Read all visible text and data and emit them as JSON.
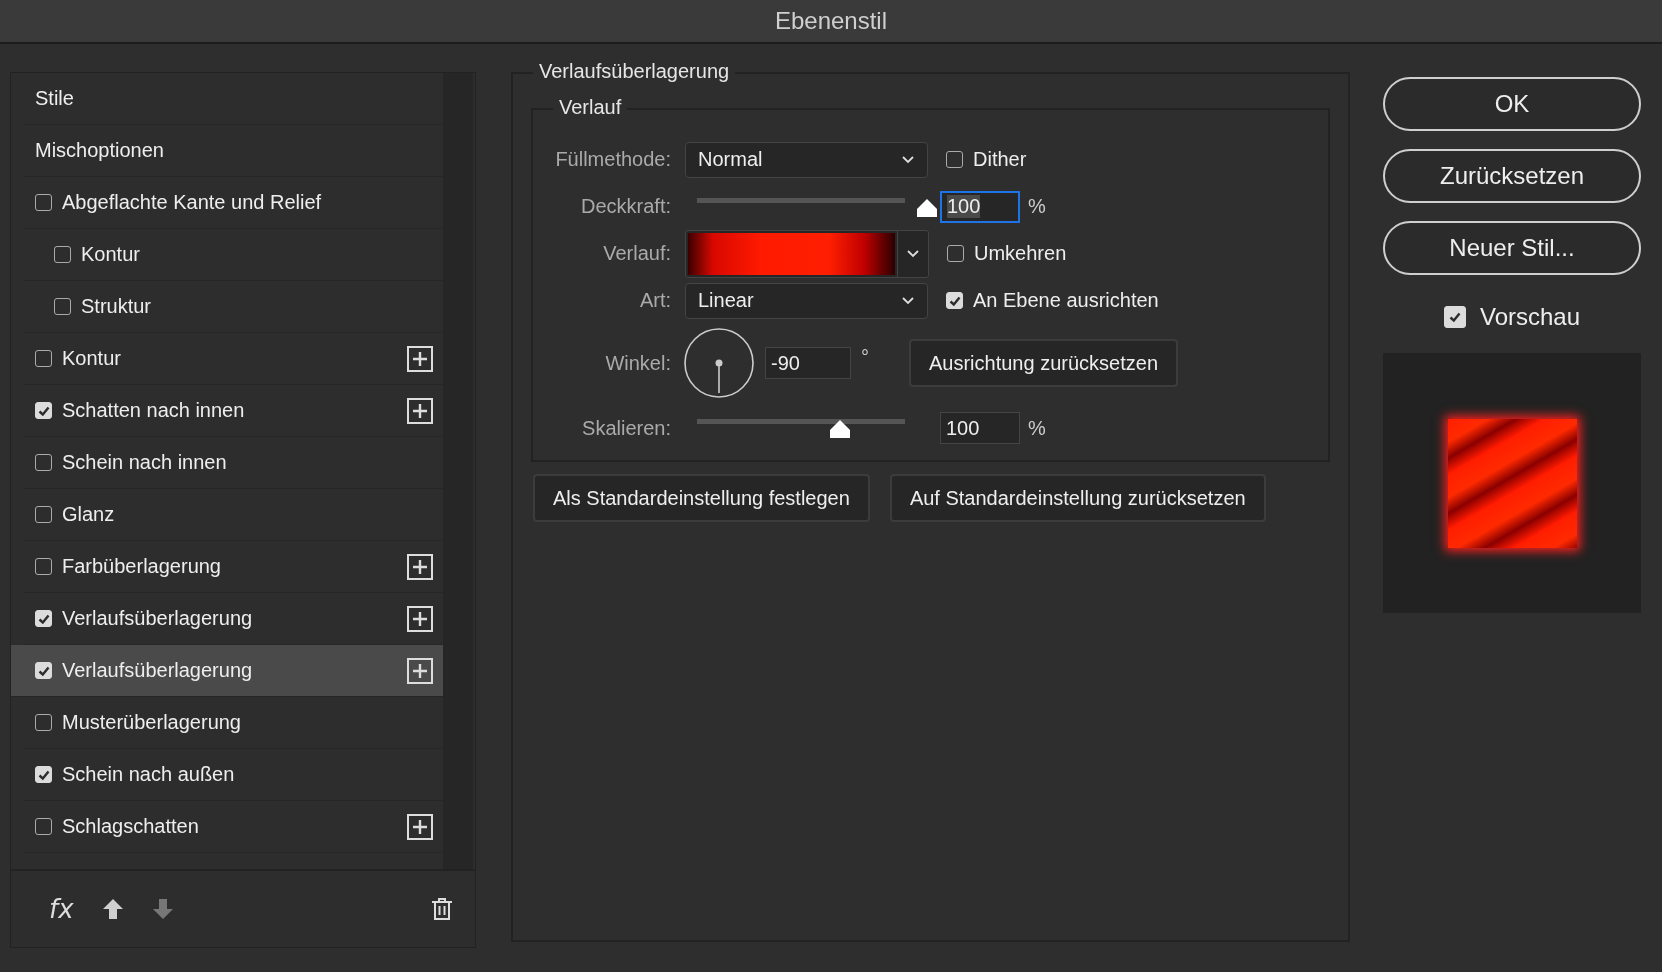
{
  "window": {
    "title": "Ebenenstil"
  },
  "sidebar": {
    "items": [
      {
        "label": "Stile",
        "kind": "plain",
        "selected": false
      },
      {
        "label": "Mischoptionen",
        "kind": "plain",
        "selected": false
      },
      {
        "label": "Abgeflachte Kante und Relief",
        "kind": "checkbox",
        "checked": false,
        "add_button": false,
        "selected": false,
        "children": [
          {
            "label": "Kontur",
            "kind": "checkbox",
            "checked": false,
            "add_button": false,
            "selected": false
          },
          {
            "label": "Struktur",
            "kind": "checkbox",
            "checked": false,
            "add_button": false,
            "selected": false
          }
        ]
      },
      {
        "label": "Kontur",
        "kind": "checkbox",
        "checked": false,
        "add_button": true,
        "selected": false
      },
      {
        "label": "Schatten nach innen",
        "kind": "checkbox",
        "checked": true,
        "add_button": true,
        "selected": false
      },
      {
        "label": "Schein nach innen",
        "kind": "checkbox",
        "checked": false,
        "add_button": false,
        "selected": false
      },
      {
        "label": "Glanz",
        "kind": "checkbox",
        "checked": false,
        "add_button": false,
        "selected": false
      },
      {
        "label": "Farbüberlagerung",
        "kind": "checkbox",
        "checked": false,
        "add_button": true,
        "selected": false
      },
      {
        "label": "Verlaufsüberlagerung",
        "kind": "checkbox",
        "checked": true,
        "add_button": true,
        "selected": false
      },
      {
        "label": "Verlaufsüberlagerung",
        "kind": "checkbox",
        "checked": true,
        "add_button": true,
        "selected": true
      },
      {
        "label": "Musterüberlagerung",
        "kind": "checkbox",
        "checked": false,
        "add_button": false,
        "selected": false
      },
      {
        "label": "Schein nach außen",
        "kind": "checkbox",
        "checked": true,
        "add_button": false,
        "selected": false
      },
      {
        "label": "Schlagschatten",
        "kind": "checkbox",
        "checked": false,
        "add_button": true,
        "selected": false
      }
    ],
    "footer": [
      {
        "kind": "effects",
        "label": "fx"
      },
      {
        "kind": "up",
        "disabled": false
      },
      {
        "kind": "down",
        "disabled": true
      },
      {
        "kind": "delete"
      }
    ]
  },
  "panel": {
    "title": "Verlaufsüberlagerung",
    "group_title": "Verlauf",
    "rows": [
      {
        "kind": "select",
        "label": "Füllmethode:",
        "value": "Normal",
        "option": {
          "label": "Dither",
          "checked": false
        }
      },
      {
        "kind": "slider",
        "label": "Deckkraft:",
        "level": 1.0,
        "value": "100",
        "unit": "%",
        "focused": true
      },
      {
        "kind": "gradient",
        "label": "Verlauf:",
        "option": {
          "label": "Umkehren",
          "checked": false
        }
      },
      {
        "kind": "select",
        "label": "Art:",
        "value": "Linear",
        "option": {
          "label": "An Ebene ausrichten",
          "checked": true
        }
      },
      {
        "kind": "angle",
        "label": "Winkel:",
        "value": "-90",
        "unit": "°",
        "button": "Ausrichtung zurücksetzen"
      },
      {
        "kind": "slider",
        "label": "Skalieren:",
        "level": 0.62,
        "value": "100",
        "unit": "%",
        "focused": false
      }
    ],
    "buttons": [
      "Als Standardeinstellung festlegen",
      "Auf Standardeinstellung zurücksetzen"
    ]
  },
  "actions": {
    "buttons": [
      "OK",
      "Zurücksetzen",
      "Neuer Stil..."
    ],
    "preview": {
      "label": "Vorschau",
      "checked": true
    }
  }
}
